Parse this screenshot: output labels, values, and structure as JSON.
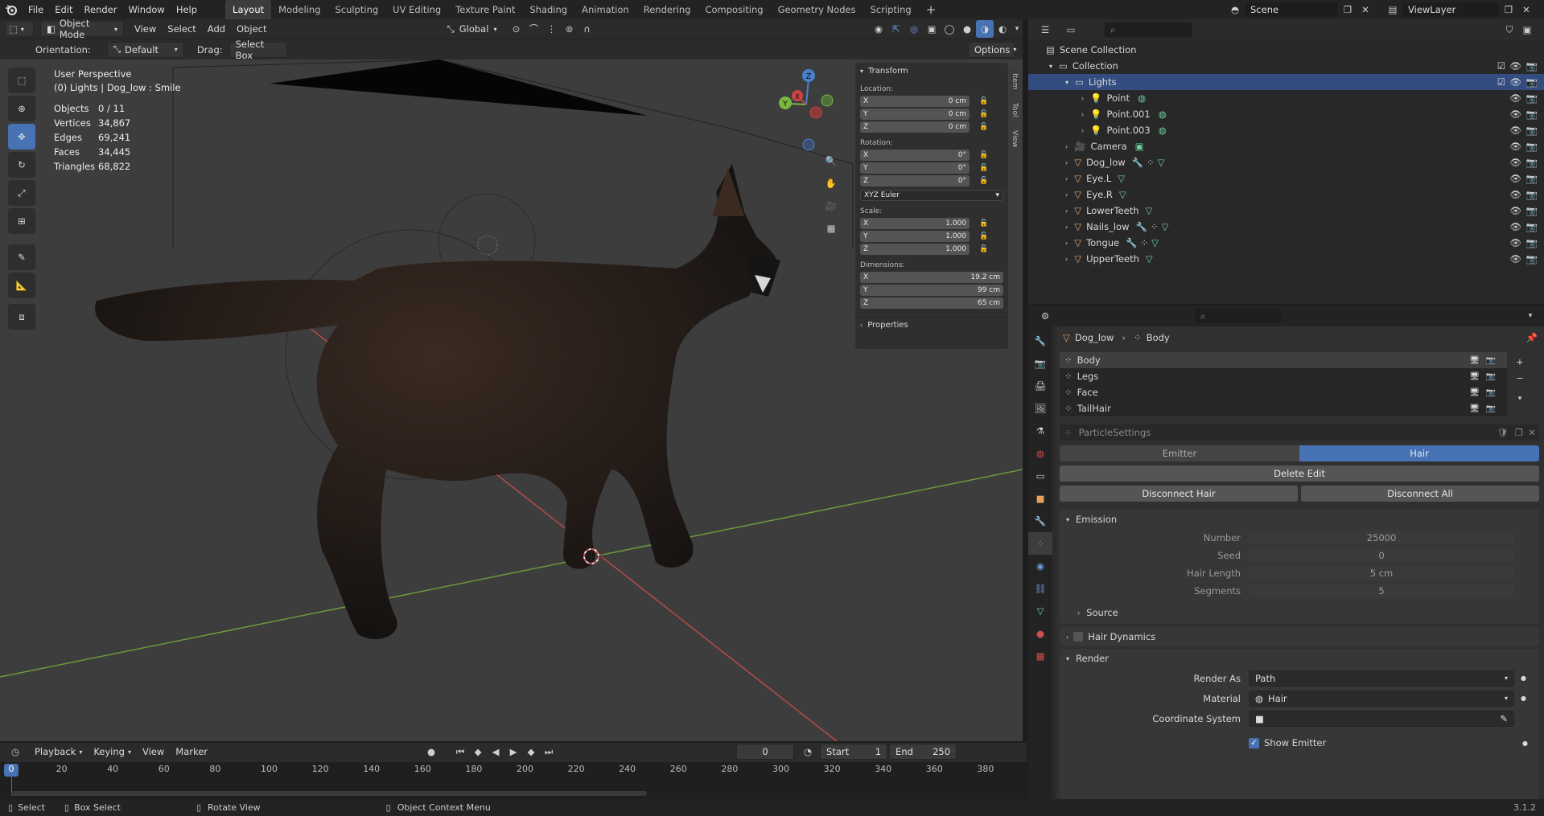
{
  "topbar": {
    "menus": [
      "File",
      "Edit",
      "Render",
      "Window",
      "Help"
    ],
    "workspaces": [
      "Layout",
      "Modeling",
      "Sculpting",
      "UV Editing",
      "Texture Paint",
      "Shading",
      "Animation",
      "Rendering",
      "Compositing",
      "Geometry Nodes",
      "Scripting"
    ],
    "active_workspace": "Layout",
    "add_tab": "+",
    "scene": "Scene",
    "view_layer": "ViewLayer"
  },
  "viewport": {
    "mode": "Object Mode",
    "menus": [
      "View",
      "Select",
      "Add",
      "Object"
    ],
    "transform_orientation": "Global",
    "orientation_label": "Orientation:",
    "orientation_value": "Default",
    "drag_label": "Drag:",
    "drag_value": "Select Box",
    "options": "Options",
    "overlay": {
      "perspective": "User Perspective",
      "context": "(0) Lights | Dog_low : Smile",
      "stats": [
        {
          "label": "Objects",
          "value": "0 / 11"
        },
        {
          "label": "Vertices",
          "value": "34,867"
        },
        {
          "label": "Edges",
          "value": "69,241"
        },
        {
          "label": "Faces",
          "value": "34,445"
        },
        {
          "label": "Triangles",
          "value": "68,822"
        }
      ]
    },
    "gizmo_axes": [
      "X",
      "Y",
      "Z"
    ]
  },
  "npanel": {
    "tabs": [
      "Item",
      "Tool",
      "View"
    ],
    "title": "Transform",
    "location_label": "Location:",
    "location": [
      {
        "axis": "X",
        "value": "0 cm"
      },
      {
        "axis": "Y",
        "value": "0 cm"
      },
      {
        "axis": "Z",
        "value": "0 cm"
      }
    ],
    "rotation_label": "Rotation:",
    "rotation": [
      {
        "axis": "X",
        "value": "0°"
      },
      {
        "axis": "Y",
        "value": "0°"
      },
      {
        "axis": "Z",
        "value": "0°"
      }
    ],
    "rotation_mode": "XYZ Euler",
    "scale_label": "Scale:",
    "scale": [
      {
        "axis": "X",
        "value": "1.000"
      },
      {
        "axis": "Y",
        "value": "1.000"
      },
      {
        "axis": "Z",
        "value": "1.000"
      }
    ],
    "dimensions_label": "Dimensions:",
    "dimensions": [
      {
        "axis": "X",
        "value": "19.2 cm"
      },
      {
        "axis": "Y",
        "value": "99 cm"
      },
      {
        "axis": "Z",
        "value": "65 cm"
      }
    ],
    "properties": "Properties"
  },
  "outliner": {
    "root": "Scene Collection",
    "collection": "Collection",
    "items": [
      {
        "name": "Lights",
        "type": "collection",
        "selected": true
      },
      {
        "name": "Point",
        "type": "light"
      },
      {
        "name": "Point.001",
        "type": "light"
      },
      {
        "name": "Point.003",
        "type": "light"
      },
      {
        "name": "Camera",
        "type": "camera"
      },
      {
        "name": "Dog_low",
        "type": "mesh"
      },
      {
        "name": "Eye.L",
        "type": "mesh"
      },
      {
        "name": "Eye.R",
        "type": "mesh"
      },
      {
        "name": "LowerTeeth",
        "type": "mesh"
      },
      {
        "name": "Nails_low",
        "type": "mesh"
      },
      {
        "name": "Tongue",
        "type": "mesh"
      },
      {
        "name": "UpperTeeth",
        "type": "mesh"
      }
    ]
  },
  "properties": {
    "breadcrumb_object": "Dog_low",
    "breadcrumb_system": "Body",
    "systems": [
      "Body",
      "Legs",
      "Face",
      "TailHair"
    ],
    "settings_name": "ParticleSettings",
    "type_options": [
      "Emitter",
      "Hair"
    ],
    "type_active": "Hair",
    "delete_edit": "Delete Edit",
    "disconnect_hair": "Disconnect Hair",
    "disconnect_all": "Disconnect All",
    "emission_title": "Emission",
    "emission": [
      {
        "label": "Number",
        "value": "25000"
      },
      {
        "label": "Seed",
        "value": "0"
      },
      {
        "label": "Hair Length",
        "value": "5 cm"
      },
      {
        "label": "Segments",
        "value": "5"
      }
    ],
    "source": "Source",
    "hair_dynamics": "Hair Dynamics",
    "render_title": "Render",
    "render_as_label": "Render As",
    "render_as": "Path",
    "material_label": "Material",
    "material": "Hair",
    "coord_label": "Coordinate System",
    "show_emitter": "Show Emitter"
  },
  "timeline": {
    "menus": [
      "Playback",
      "Keying",
      "View",
      "Marker"
    ],
    "current_frame": "0",
    "start_label": "Start",
    "start": "1",
    "end_label": "End",
    "end": "250",
    "ticks": [
      "0",
      "20",
      "40",
      "60",
      "80",
      "100",
      "120",
      "140",
      "160",
      "180",
      "200",
      "220",
      "240",
      "260",
      "280",
      "300",
      "320",
      "340",
      "360",
      "380"
    ]
  },
  "statusbar": {
    "select": "Select",
    "box_select": "Box Select",
    "rotate_view": "Rotate View",
    "context_menu": "Object Context Menu",
    "version": "3.1.2"
  },
  "colors": {
    "accent": "#4772b3",
    "selected_row": "#334d80",
    "x_axis": "#cc4444",
    "y_axis": "#7ab640",
    "z_axis": "#4a80d0"
  }
}
